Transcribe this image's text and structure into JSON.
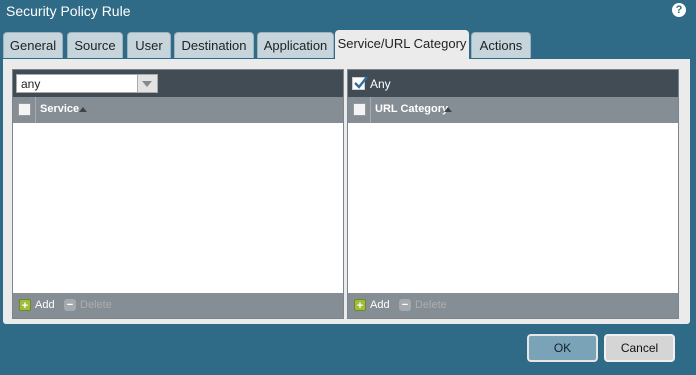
{
  "window": {
    "title": "Security Policy Rule",
    "help_icon": "?"
  },
  "tabs": [
    {
      "label": "General"
    },
    {
      "label": "Source"
    },
    {
      "label": "User"
    },
    {
      "label": "Destination"
    },
    {
      "label": "Application"
    },
    {
      "label": "Service/URL Category",
      "active": true
    },
    {
      "label": "Actions"
    }
  ],
  "service_panel": {
    "selected_value": "any",
    "column_header": "Service",
    "add_label": "Add",
    "delete_label": "Delete",
    "rows": []
  },
  "url_panel": {
    "any_label": "Any",
    "any_checked": true,
    "column_header": "URL Category",
    "add_label": "Add",
    "delete_label": "Delete",
    "rows": []
  },
  "buttons": {
    "ok": "OK",
    "cancel": "Cancel"
  },
  "colors": {
    "title_bar": "#2f6a86",
    "panel_header_dark": "#414c54",
    "column_header": "#858e95",
    "add_icon": "#9dbd3b",
    "ok_button": "#7aa3b7"
  },
  "icons": {
    "help": "question-circle-icon",
    "add": "plus-square-icon",
    "delete": "minus-square-icon",
    "sort": "sort-ascending-icon",
    "dropdown": "chevron-down-icon",
    "check": "checkmark-icon"
  }
}
